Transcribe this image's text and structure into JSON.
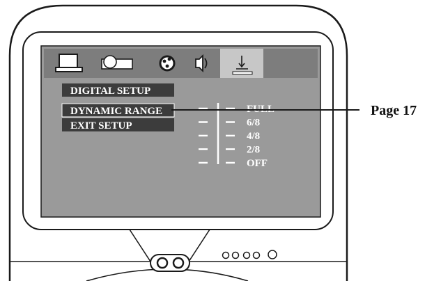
{
  "osd": {
    "tabs": [
      {
        "icon": "monitor-icon"
      },
      {
        "icon": "speaker-box-icon"
      },
      {
        "icon": "dial-icon"
      },
      {
        "icon": "audio-icon"
      },
      {
        "icon": "setup-arrow-icon",
        "selected": true
      }
    ],
    "menu": {
      "title": "DIGITAL SETUP",
      "items": [
        {
          "label": "DYNAMIC RANGE",
          "highlighted": true
        },
        {
          "label": "EXIT SETUP"
        }
      ]
    },
    "levels": [
      "FULL",
      "6/8",
      "4/8",
      "2/8",
      "OFF"
    ]
  },
  "callout": {
    "label": "Page 17"
  },
  "tv": {
    "front_buttons": [
      "button-1",
      "button-2",
      "button-3",
      "button-4",
      "button-5"
    ]
  },
  "colors": {
    "screen_bg": "#9a9a9a",
    "tab_bar": "#7d7d7d",
    "menu_bar": "#3c3c3c",
    "outline": "#1a1a1a",
    "selected_tab": "#d0d0d0"
  }
}
